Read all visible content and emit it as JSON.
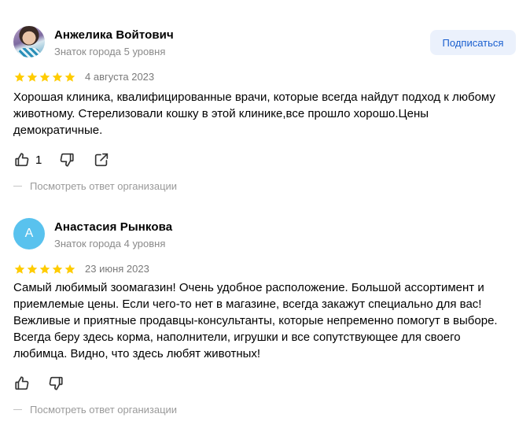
{
  "reviews": [
    {
      "author": "Анжелика Войтович",
      "level": "Знаток города 5 уровня",
      "rating": 5,
      "date": "4 августа 2023",
      "text": "Хорошая клиника, квалифицированные врачи, которые всегда найдут подход к любому животному. Стерелизовали кошку в этой клинике,все прошло хорошо.Цены демократичные.",
      "likes": "1",
      "subscribe_label": "Подписаться",
      "org_reply_label": "Посмотреть ответ организации"
    },
    {
      "author": "Анастасия Рынкова",
      "avatar_letter": "А",
      "level": "Знаток города 4 уровня",
      "rating": 5,
      "date": "23 июня 2023",
      "text": "Самый любимый зоомагазин! Очень удобное расположение. Большой ассортимент и приемлемые цены. Если чего-то нет в магазине, всегда закажут специально для вас! Вежливые и приятные продавцы-консультанты, которые непременно помогут в выборе. Всегда беру здесь корма, наполнители, игрушки и все сопутствующее для своего любимца. Видно, что здесь любят животных!",
      "org_reply_label": "Посмотреть ответ организации"
    }
  ],
  "colors": {
    "star": "#fc0",
    "accent": "#1a5fcf",
    "avatar_bg": "#59c2ee"
  },
  "icons": [
    "thumbs-up-icon",
    "thumbs-down-icon",
    "share-icon",
    "star-icon"
  ]
}
